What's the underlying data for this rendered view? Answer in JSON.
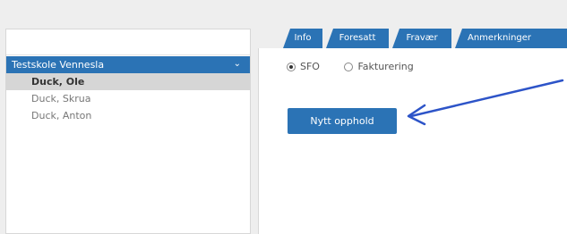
{
  "sidebar": {
    "school": "Testskole Vennesla",
    "students": [
      {
        "name": "Duck, Ole",
        "selected": true
      },
      {
        "name": "Duck, Skrua",
        "selected": false
      },
      {
        "name": "Duck, Anton",
        "selected": false
      }
    ]
  },
  "tabs": [
    "Info",
    "Foresatt",
    "Fravær",
    "Anmerkninger"
  ],
  "radios": [
    {
      "label": "SFO",
      "checked": true
    },
    {
      "label": "Fakturering",
      "checked": false
    }
  ],
  "buttons": {
    "new_stay": "Nytt opphold"
  },
  "colors": {
    "accent": "#2b73b5",
    "annotation_arrow": "#2d54c8"
  }
}
